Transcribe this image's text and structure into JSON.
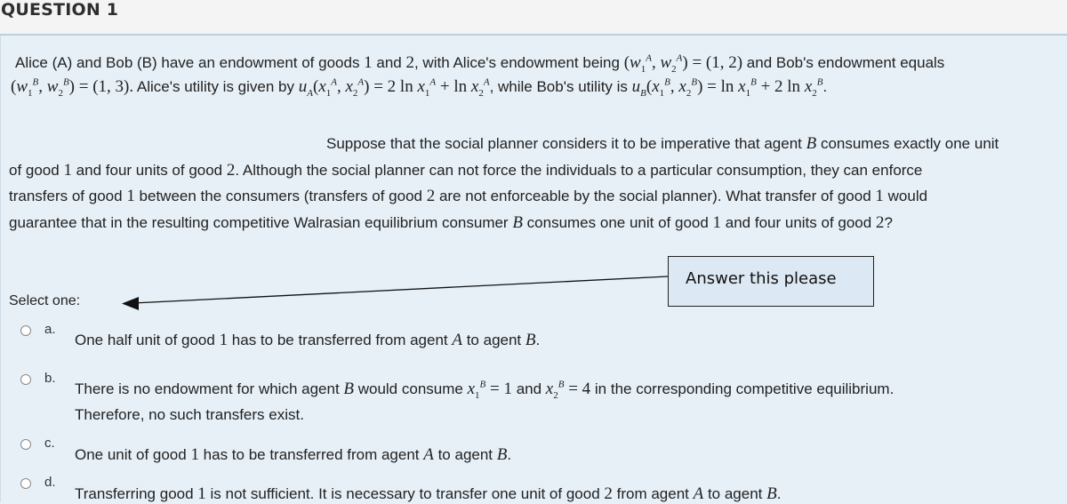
{
  "header": {
    "title": "QUESTION 1"
  },
  "question": {
    "intro_line1": {
      "t1": "Alice (A) and Bob (B) have an endowment of goods ",
      "n1": "1",
      "t2": " and ",
      "n2": "2",
      "t3": ", with Alice's endowment being ",
      "math1": "(w₁ᴬ, w₂ᴬ) = (1, 2)",
      "t4": " and Bob's endowment equals"
    },
    "intro_line2": {
      "math1": "(w₁ᴮ, w₂ᴮ) = (1, 3).",
      "t1": " Alice's utility is given by ",
      "math2": "u_A(x₁ᴬ, x₂ᴬ) = 2 ln x₁ᴬ + ln x₂ᴬ",
      "t2": ", while Bob's utility is ",
      "math3": "u_B(x₁ᴮ, x₂ᴮ) = ln x₁ᴮ + 2 ln x₂ᴮ",
      "t3": "."
    },
    "body_line1": {
      "t1": "Suppose that the social planner considers it to be imperative that agent ",
      "B": "B",
      "t2": " consumes exactly one unit"
    },
    "body_line2": {
      "t1": "of good ",
      "n1": "1",
      "t2": " and four units of good ",
      "n2": "2",
      "t3": ". Although the social planner can not force the individuals to a particular consumption, they can enforce"
    },
    "body_line3": {
      "t1": "transfers of good ",
      "n1": "1",
      "t2": " between the consumers (transfers of good ",
      "n2": "2",
      "t3": " are not enforceable by the social planner). What transfer of good ",
      "n3": "1",
      "t4": " would"
    },
    "body_line4": {
      "t1": "guarantee that in the resulting competitive Walrasian equilibrium consumer ",
      "B": "B",
      "t2": " consumes one unit of good ",
      "n1": "1",
      "t3": " and four units of good ",
      "n2": "2",
      "t4": "?"
    }
  },
  "select_label": "Select one:",
  "options": [
    {
      "letter": "a.",
      "parts": {
        "t1": "One half unit of good ",
        "n1": "1",
        "t2": " has to be transferred from agent ",
        "A": "A",
        "t3": " to agent ",
        "B": "B",
        "t4": "."
      }
    },
    {
      "letter": "b.",
      "parts": {
        "t1": "There is no endowment for which agent ",
        "B": "B",
        "t2": " would consume ",
        "m1": "x₁ᴮ = 1",
        "t3": " and ",
        "m2": "x₂ᴮ = 4",
        "t4": " in the corresponding competitive equilibrium.",
        "line2": "Therefore, no such transfers exist."
      }
    },
    {
      "letter": "c.",
      "parts": {
        "t1": "One unit of good ",
        "n1": "1",
        "t2": " has to be transferred from agent ",
        "A": "A",
        "t3": " to agent ",
        "B": "B",
        "t4": "."
      }
    },
    {
      "letter": "d.",
      "parts": {
        "t1": "Transferring good ",
        "n1": "1",
        "t2": " is not sufficient. It is necessary to transfer one unit of good ",
        "n2": "2",
        "t3": " from agent ",
        "A": "A",
        "t4": " to agent ",
        "B": "B",
        "t5": "."
      }
    }
  ],
  "annotation": {
    "callout_text": "Answer this please",
    "arrow_target": "select-one-label"
  }
}
